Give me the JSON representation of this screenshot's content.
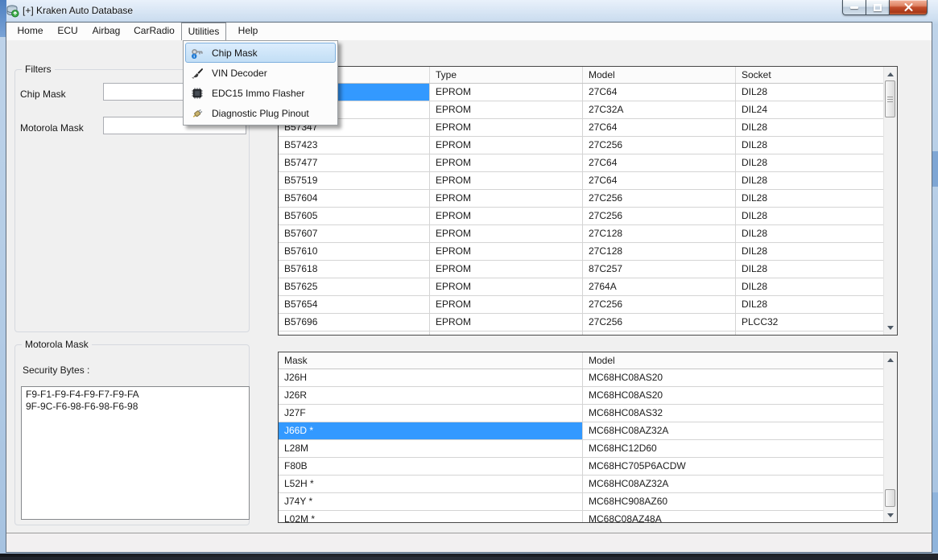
{
  "window": {
    "title": "[+] Kraken Auto Database"
  },
  "menubar": {
    "items": [
      "Home",
      "ECU",
      "Airbag",
      "CarRadio",
      "Utilities",
      "Help"
    ],
    "open_item": "Utilities"
  },
  "utilities_menu": {
    "items": [
      {
        "label": "Chip Mask",
        "icon": "key-info-icon",
        "highlighted": true
      },
      {
        "label": "VIN Decoder",
        "icon": "brush-icon",
        "highlighted": false
      },
      {
        "label": "EDC15 Immo Flasher",
        "icon": "chip-icon",
        "highlighted": false
      },
      {
        "label": "Diagnostic Plug Pinout",
        "icon": "plug-icon",
        "highlighted": false
      }
    ]
  },
  "filters": {
    "title": "Filters",
    "chip_label": "Chip Mask",
    "chip_value": "",
    "motorola_label": "Motorola Mask",
    "motorola_value": ""
  },
  "chip_table": {
    "columns": {
      "mask": "",
      "type": "Type",
      "model": "Model",
      "socket": "Socket"
    },
    "rows": [
      {
        "mask": "",
        "type": "EPROM",
        "model": "27C64",
        "socket": "DIL28",
        "selected": true
      },
      {
        "mask": "",
        "type": "EPROM",
        "model": "27C32A",
        "socket": "DIL24"
      },
      {
        "mask": "B57347",
        "type": "EPROM",
        "model": "27C64",
        "socket": "DIL28"
      },
      {
        "mask": "B57423",
        "type": "EPROM",
        "model": "27C256",
        "socket": "DIL28"
      },
      {
        "mask": "B57477",
        "type": "EPROM",
        "model": "27C64",
        "socket": "DIL28"
      },
      {
        "mask": "B57519",
        "type": "EPROM",
        "model": "27C64",
        "socket": "DIL28"
      },
      {
        "mask": "B57604",
        "type": "EPROM",
        "model": "27C256",
        "socket": "DIL28"
      },
      {
        "mask": "B57605",
        "type": "EPROM",
        "model": "27C256",
        "socket": "DIL28"
      },
      {
        "mask": "B57607",
        "type": "EPROM",
        "model": "27C128",
        "socket": "DIL28"
      },
      {
        "mask": "B57610",
        "type": "EPROM",
        "model": "27C128",
        "socket": "DIL28"
      },
      {
        "mask": "B57618",
        "type": "EPROM",
        "model": "87C257",
        "socket": "DIL28"
      },
      {
        "mask": "B57625",
        "type": "EPROM",
        "model": "2764A",
        "socket": "DIL28"
      },
      {
        "mask": "B57654",
        "type": "EPROM",
        "model": "27C256",
        "socket": "DIL28"
      },
      {
        "mask": "B57696",
        "type": "EPROM",
        "model": "27C256",
        "socket": "PLCC32"
      }
    ]
  },
  "motorola_panel": {
    "title": "Motorola Mask",
    "security_label": "Security Bytes :",
    "security_bytes": "F9-F1-F9-F4-F9-F7-F9-FA\n9F-9C-F6-98-F6-98-F6-98"
  },
  "motorola_table": {
    "columns": {
      "mask": "Mask",
      "model": "Model"
    },
    "rows": [
      {
        "mask": "J26H",
        "model": "MC68HC08AS20"
      },
      {
        "mask": "J26R",
        "model": "MC68HC08AS20"
      },
      {
        "mask": "J27F",
        "model": "MC68HC08AS32"
      },
      {
        "mask": "J66D *",
        "model": "MC68HC08AZ32A",
        "selected": true
      },
      {
        "mask": "L28M",
        "model": "MC68HC12D60"
      },
      {
        "mask": "F80B",
        "model": "MC68HC705P6ACDW"
      },
      {
        "mask": "L52H *",
        "model": "MC68HC08AZ32A"
      },
      {
        "mask": "J74Y *",
        "model": "MC68HC908AZ60"
      },
      {
        "mask": "L02M *",
        "model": "MC68C08AZ48A"
      }
    ]
  },
  "colors": {
    "selection_blue": "#3399ff",
    "menu_highlight_border": "#7fb0de",
    "titlebar_glass": "#bed3e9",
    "close_button_red": "#c24e2c",
    "client_background": "#f0f0f0"
  }
}
